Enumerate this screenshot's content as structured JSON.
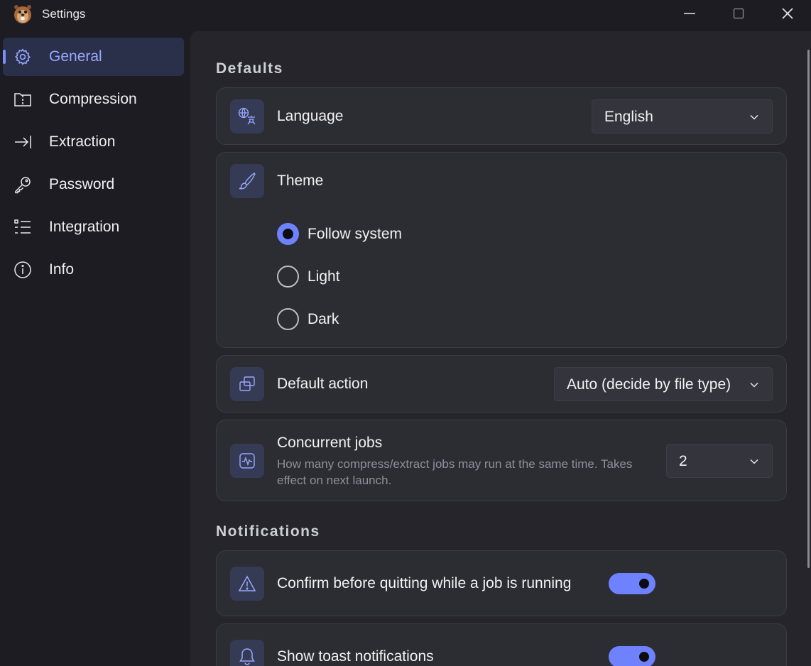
{
  "window": {
    "title": "Settings",
    "controls": [
      "minimize-icon",
      "maximize-icon",
      "close-icon"
    ]
  },
  "sidebar": {
    "items": [
      {
        "label": "General",
        "icon": "gear-icon",
        "active": true
      },
      {
        "label": "Compression",
        "icon": "archive-icon",
        "active": false
      },
      {
        "label": "Extraction",
        "icon": "arrow-to-line-icon",
        "active": false
      },
      {
        "label": "Password",
        "icon": "key-icon",
        "active": false
      },
      {
        "label": "Integration",
        "icon": "list-icon",
        "active": false
      },
      {
        "label": "Info",
        "icon": "info-icon",
        "active": false
      }
    ]
  },
  "defaults": {
    "section_title": "Defaults",
    "language": {
      "label": "Language",
      "value": "English",
      "icon": "translate-icon"
    },
    "theme": {
      "label": "Theme",
      "icon": "brush-icon",
      "options": [
        {
          "label": "Follow system",
          "selected": true
        },
        {
          "label": "Light",
          "selected": false
        },
        {
          "label": "Dark",
          "selected": false
        }
      ]
    },
    "default_action": {
      "label": "Default action",
      "value": "Auto (decide by file type)",
      "icon": "windows-stack-icon"
    },
    "concurrent_jobs": {
      "label": "Concurrent jobs",
      "description": "How many compress/extract jobs may run at the same time. Takes effect on next launch.",
      "value": "2",
      "icon": "activity-icon"
    }
  },
  "notifications": {
    "section_title": "Notifications",
    "confirm_quit": {
      "label": "Confirm before quitting while a job is running",
      "enabled": true,
      "icon": "warning-icon"
    },
    "toast": {
      "label": "Show toast notifications",
      "enabled": true,
      "icon": "bell-icon"
    }
  },
  "colors": {
    "accent": "#6e82ff",
    "background": "#1c1c22",
    "panel": "#25252b",
    "card": "#2c2c33",
    "active_nav": "#2a2f4a"
  }
}
